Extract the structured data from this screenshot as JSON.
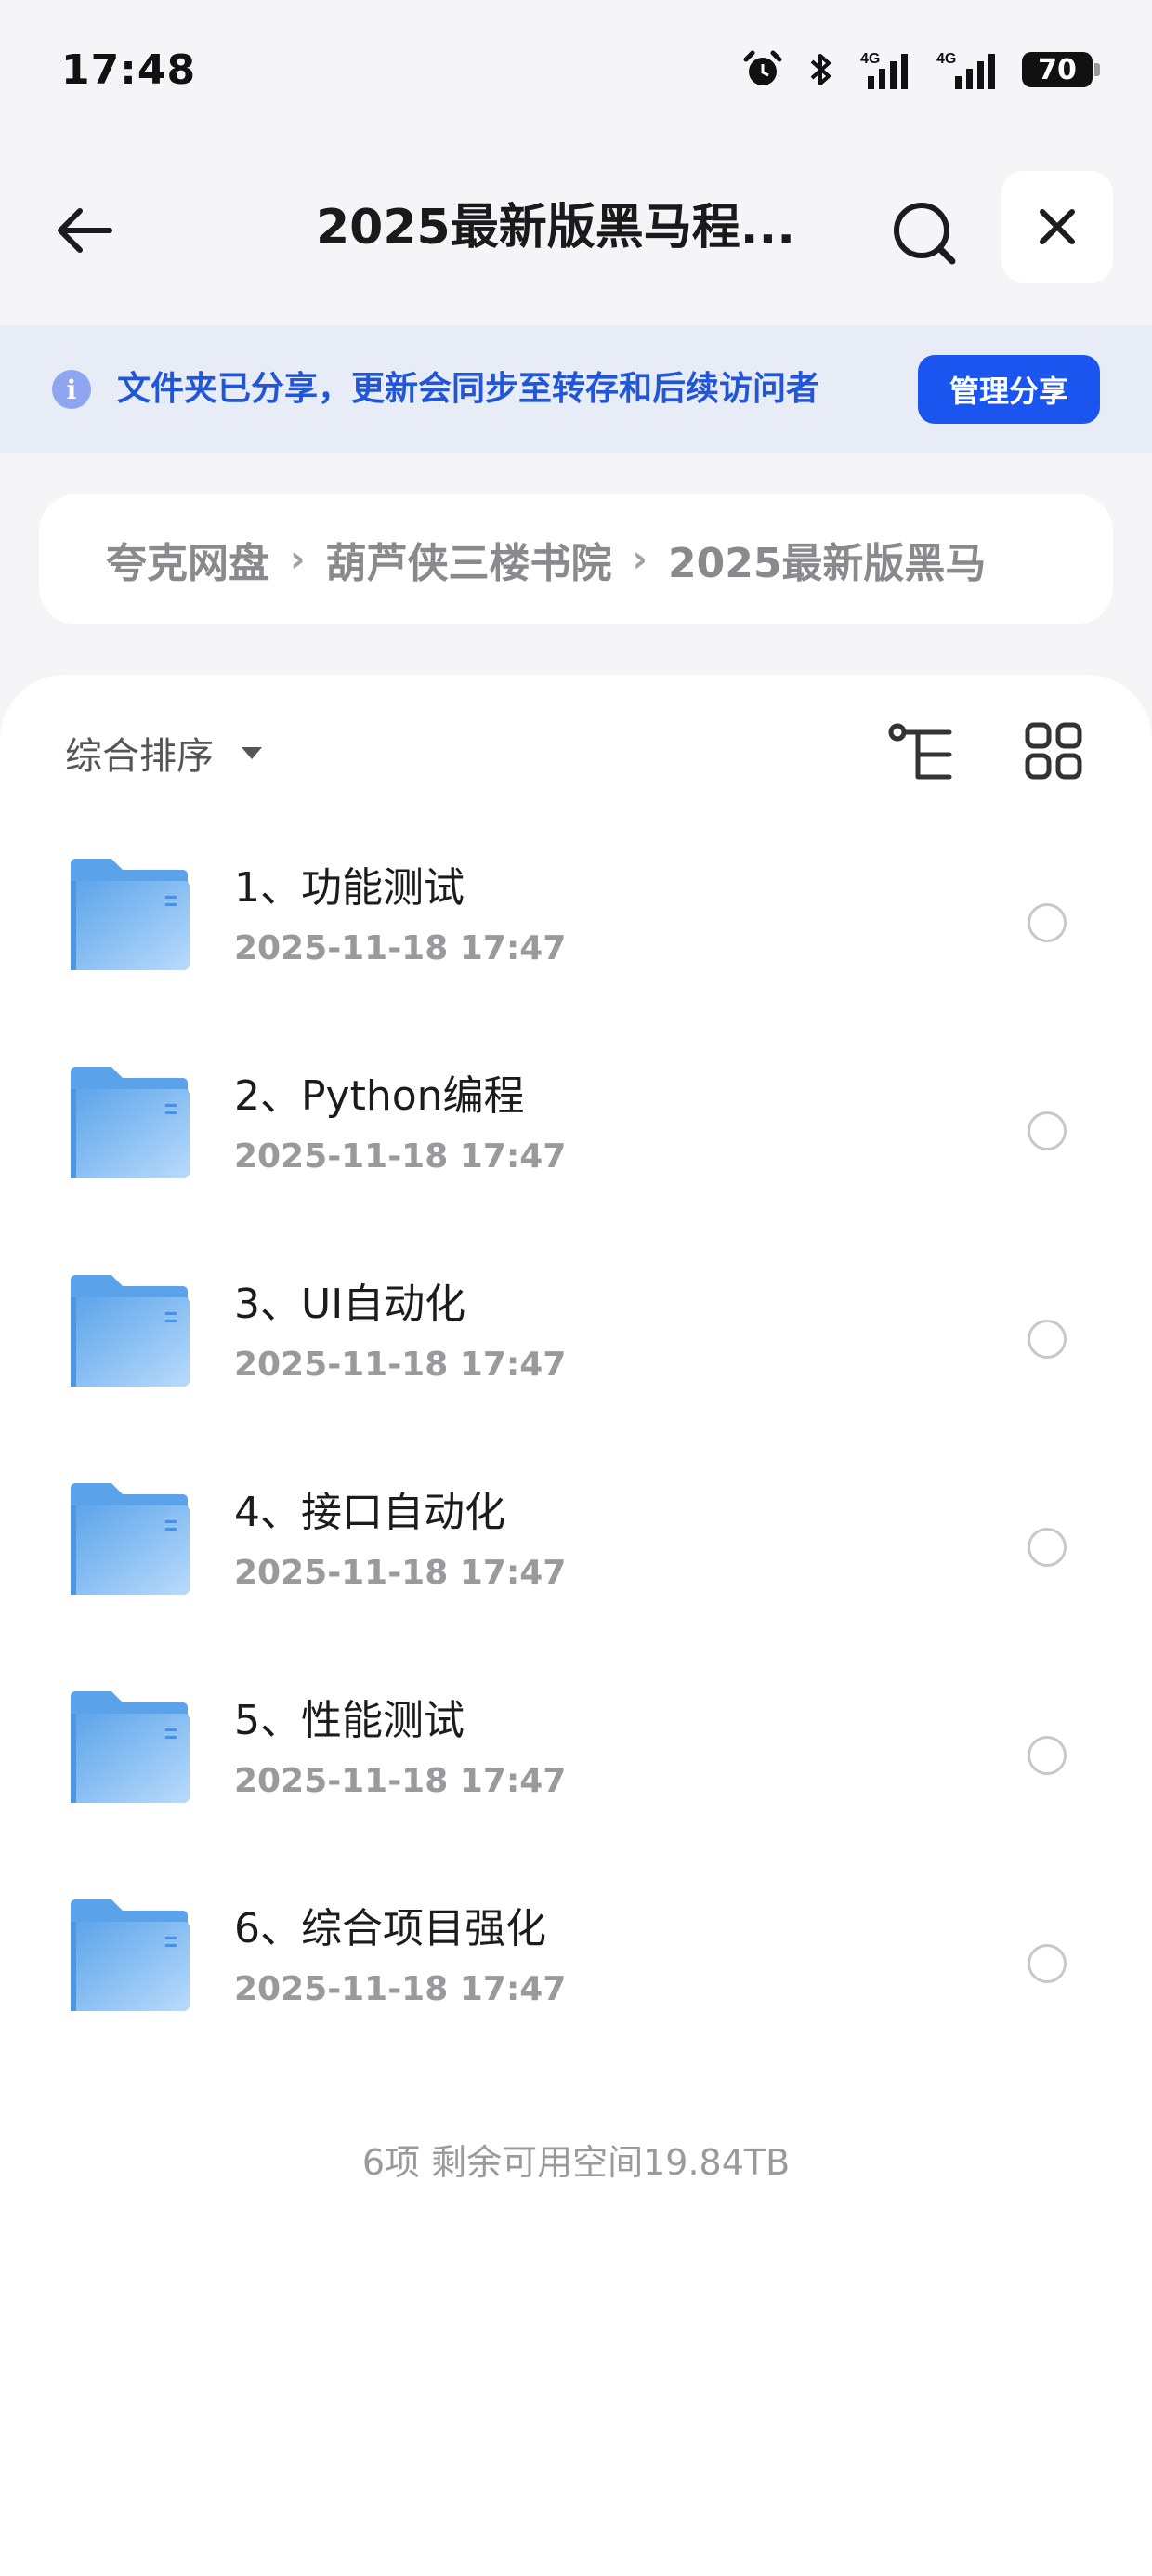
{
  "status_bar": {
    "time": "17:48",
    "battery": "70",
    "icons": [
      "alarm-icon",
      "bluetooth-icon",
      "signal-4g-icon",
      "signal-4g-icon"
    ],
    "network_label_1": "4G",
    "network_label_2": "4G"
  },
  "header": {
    "title": "2025最新版黑马程...",
    "back_icon": "arrow-left-icon",
    "search_icon": "search-icon",
    "close_icon": "close-icon"
  },
  "share_banner": {
    "icon": "info-icon",
    "icon_glyph": "i",
    "text": "文件夹已分享，更新会同步至转存和后续访问者",
    "button_label": "管理分享"
  },
  "breadcrumb": {
    "items": [
      "夸克网盘",
      "葫芦侠三楼书院",
      "2025最新版黑马"
    ],
    "separator": "›"
  },
  "toolbar": {
    "sort_label": "综合排序",
    "tree_icon": "tree-view-icon",
    "grid_icon": "grid-view-icon"
  },
  "files": [
    {
      "name": "1、功能测试",
      "date": "2025-11-18 17:47"
    },
    {
      "name": "2、Python编程",
      "date": "2025-11-18 17:47"
    },
    {
      "name": "3、UI自动化",
      "date": "2025-11-18 17:47"
    },
    {
      "name": "4、接口自动化",
      "date": "2025-11-18 17:47"
    },
    {
      "name": "5、性能测试",
      "date": "2025-11-18 17:47"
    },
    {
      "name": "6、综合项目强化",
      "date": "2025-11-18 17:47"
    }
  ],
  "footer": {
    "summary": "6项 剩余可用空间19.84TB"
  },
  "colors": {
    "accent": "#1a55f0",
    "banner_bg": "#e8ecf7",
    "banner_text": "#2156d6",
    "folder_blue": "#6aaef0"
  }
}
